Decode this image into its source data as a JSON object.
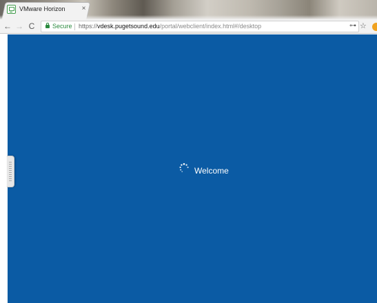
{
  "browser": {
    "tab": {
      "title": "VMware Horizon",
      "close": "×"
    },
    "nav": {
      "back": "←",
      "forward": "→",
      "reload": "C"
    },
    "address_bar": {
      "secure_label": "Secure",
      "url_scheme": "https://",
      "url_host": "vdesk.pugetsound.edu",
      "url_path": "/portal/webclient/index.html#/desktop"
    },
    "toolbar_icons": [
      "key-icon",
      "star-icon",
      "extension-icon"
    ],
    "key_glyph": "⊶",
    "star_glyph": "☆"
  },
  "page": {
    "welcome_text": "Welcome",
    "background_color": "#0b5ba4",
    "text_color": "#ffffff"
  }
}
